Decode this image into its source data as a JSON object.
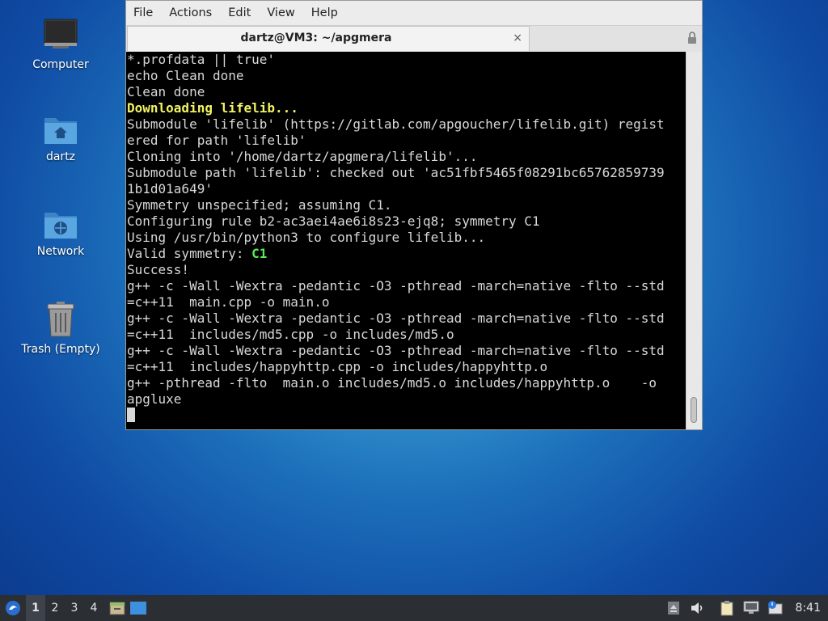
{
  "desktop": {
    "icons": [
      {
        "label": "Computer",
        "icon": "monitor-icon"
      },
      {
        "label": "dartz",
        "icon": "home-folder-icon"
      },
      {
        "label": "Network",
        "icon": "network-folder-icon"
      },
      {
        "label": "Trash (Empty)",
        "icon": "trash-icon"
      }
    ]
  },
  "window": {
    "menu": [
      "File",
      "Actions",
      "Edit",
      "View",
      "Help"
    ],
    "tab": {
      "title": "dartz@VM3: ~/apgmera",
      "close": "×"
    },
    "terminal": {
      "lines": [
        "*.profdata || true'",
        "echo Clean done",
        "Clean done",
        "Downloading lifelib...",
        "Submodule 'lifelib' (https://gitlab.com/apgoucher/lifelib.git) regist",
        "ered for path 'lifelib'",
        "Cloning into '/home/dartz/apgmera/lifelib'...",
        "Submodule path 'lifelib': checked out 'ac51fbf5465f08291bc65762859739",
        "1b1d01a649'",
        "Symmetry unspecified; assuming C1.",
        "Configuring rule b2-ac3aei4ae6i8s23-ejq8; symmetry C1",
        "Using /usr/bin/python3 to configure lifelib...",
        "Valid symmetry: ",
        "C1",
        "Success!",
        "g++ -c -Wall -Wextra -pedantic -O3 -pthread -march=native -flto --std",
        "=c++11  main.cpp -o main.o",
        "g++ -c -Wall -Wextra -pedantic -O3 -pthread -march=native -flto --std",
        "=c++11  includes/md5.cpp -o includes/md5.o",
        "g++ -c -Wall -Wextra -pedantic -O3 -pthread -march=native -flto --std",
        "=c++11  includes/happyhttp.cpp -o includes/happyhttp.o",
        "g++ -pthread -flto  main.o includes/md5.o includes/happyhttp.o    -o",
        "apgluxe"
      ]
    }
  },
  "taskbar": {
    "workspaces": [
      "1",
      "2",
      "3",
      "4"
    ],
    "clock": "8:41"
  },
  "colors": {
    "terminal_bg": "#000000",
    "terminal_fg": "#d8d8d8",
    "highlight_yellow": "#f3f364",
    "highlight_green": "#55ee55",
    "taskbar_bg": "#2b2e33"
  }
}
